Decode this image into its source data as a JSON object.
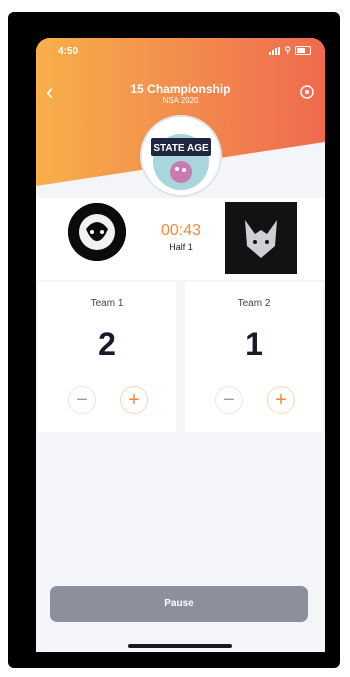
{
  "status_bar": {
    "time": "4:50"
  },
  "header": {
    "title": "15 Championship",
    "subtitle": "NSA 2020",
    "logo_text": "STATE AGE",
    "gradient_colors": [
      "#f7b04a",
      "#ef6a4f"
    ]
  },
  "match": {
    "timer": "00:43",
    "period": "Half 1",
    "accent_color": "#ef8a3e"
  },
  "teams": [
    {
      "name": "Team 1",
      "score": "2",
      "minus_icon": "minus-icon",
      "plus_icon": "plus-icon"
    },
    {
      "name": "Team 2",
      "score": "1",
      "minus_icon": "minus-icon",
      "plus_icon": "plus-icon"
    }
  ],
  "footer": {
    "pause_label": "Pause"
  }
}
